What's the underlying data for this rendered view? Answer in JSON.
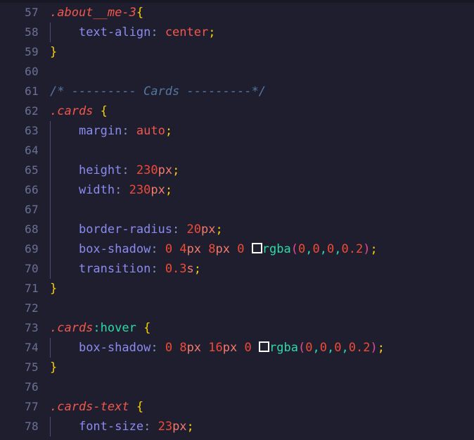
{
  "editor": {
    "language": "css",
    "theme": "dark-navy",
    "background_color": "#1e1e2e",
    "gutter_color": "#6c7195",
    "first_visible_line": 57,
    "last_visible_line": 78
  },
  "lines": [
    {
      "number": "57",
      "indent": false,
      "text": ".about__me-3{"
    },
    {
      "number": "58",
      "indent": true,
      "text": "    text-align: center;"
    },
    {
      "number": "59",
      "indent": false,
      "text": "}"
    },
    {
      "number": "60",
      "indent": false,
      "text": ""
    },
    {
      "number": "61",
      "indent": false,
      "text": "/* --------- Cards ---------*/"
    },
    {
      "number": "62",
      "indent": false,
      "text": ".cards {"
    },
    {
      "number": "63",
      "indent": true,
      "text": "    margin: auto;"
    },
    {
      "number": "64",
      "indent": true,
      "text": ""
    },
    {
      "number": "65",
      "indent": true,
      "text": "    height: 230px;"
    },
    {
      "number": "66",
      "indent": true,
      "text": "    width: 230px;"
    },
    {
      "number": "67",
      "indent": true,
      "text": ""
    },
    {
      "number": "68",
      "indent": true,
      "text": "    border-radius: 20px;"
    },
    {
      "number": "69",
      "indent": true,
      "text": "    box-shadow: 0 4px 8px 0 rgba(0,0,0,0.2);"
    },
    {
      "number": "70",
      "indent": true,
      "text": "    transition: 0.3s;"
    },
    {
      "number": "71",
      "indent": false,
      "text": "}"
    },
    {
      "number": "72",
      "indent": false,
      "text": ""
    },
    {
      "number": "73",
      "indent": false,
      "text": ".cards:hover {"
    },
    {
      "number": "74",
      "indent": true,
      "text": "    box-shadow: 0 8px 16px 0 rgba(0,0,0,0.2);"
    },
    {
      "number": "75",
      "indent": false,
      "text": "}"
    },
    {
      "number": "76",
      "indent": false,
      "text": ""
    },
    {
      "number": "77",
      "indent": false,
      "text": ".cards-text {"
    },
    {
      "number": "78",
      "indent": true,
      "text": "    font-size: 23px;"
    }
  ],
  "tokens": {
    "l57": {
      "selector": ".about__me-3",
      "brace": "{"
    },
    "l58": {
      "property": "text-align",
      "colon": ":",
      "value": "center",
      "semi": ";"
    },
    "l59": {
      "brace": "}"
    },
    "l61": {
      "comment": "/* --------- Cards ---------*/"
    },
    "l62": {
      "selector": ".cards",
      "brace": "{"
    },
    "l63": {
      "property": "margin",
      "colon": ":",
      "value": "auto",
      "semi": ";"
    },
    "l65": {
      "property": "height",
      "colon": ":",
      "num": "230",
      "unit": "px",
      "semi": ";"
    },
    "l66": {
      "property": "width",
      "colon": ":",
      "num": "230",
      "unit": "px",
      "semi": ";"
    },
    "l68": {
      "property": "border-radius",
      "colon": ":",
      "num": "20",
      "unit": "px",
      "semi": ";"
    },
    "l69": {
      "property": "box-shadow",
      "colon": ":",
      "n1": "0",
      "n2": "4",
      "u2": "px",
      "n3": "8",
      "u3": "px",
      "n4": "0",
      "fn": "rgba",
      "open": "(",
      "a1": "0",
      "c1": ",",
      "a2": "0",
      "c2": ",",
      "a3": "0",
      "c3": ",",
      "a4": "0.2",
      "close": ")",
      "semi": ";"
    },
    "l70": {
      "property": "transition",
      "colon": ":",
      "num": "0.3",
      "unit": "s",
      "semi": ";"
    },
    "l71": {
      "brace": "}"
    },
    "l73": {
      "selector": ".cards",
      "pseudo": ":hover",
      "brace": "{"
    },
    "l74": {
      "property": "box-shadow",
      "colon": ":",
      "n1": "0",
      "n2": "8",
      "u2": "px",
      "n3": "16",
      "u3": "px",
      "n4": "0",
      "fn": "rgba",
      "open": "(",
      "a1": "0",
      "c1": ",",
      "a2": "0",
      "c2": ",",
      "a3": "0",
      "c3": ",",
      "a4": "0.2",
      "close": ")",
      "semi": ";"
    },
    "l75": {
      "brace": "}"
    },
    "l77": {
      "selector": ".cards-text",
      "brace": "{"
    },
    "l78": {
      "property": "font-size",
      "colon": ":",
      "num": "23",
      "unit": "px",
      "semi": ";"
    }
  },
  "colors": {
    "background": "#1e1e2e",
    "line_number": "#6c7195",
    "selector": "#f3574d",
    "pseudo_class": "#2fd9a8",
    "brace": "#f7d000",
    "property": "#8c8bf0",
    "value": "#f3574d",
    "number": "#f14b37",
    "unit": "#f47b6d",
    "comment": "#56769e",
    "function": "#2fd9a8",
    "paren": "#e64c8f",
    "indent_guide": "#4e4f6e",
    "swatch_border": "#ffffff"
  }
}
